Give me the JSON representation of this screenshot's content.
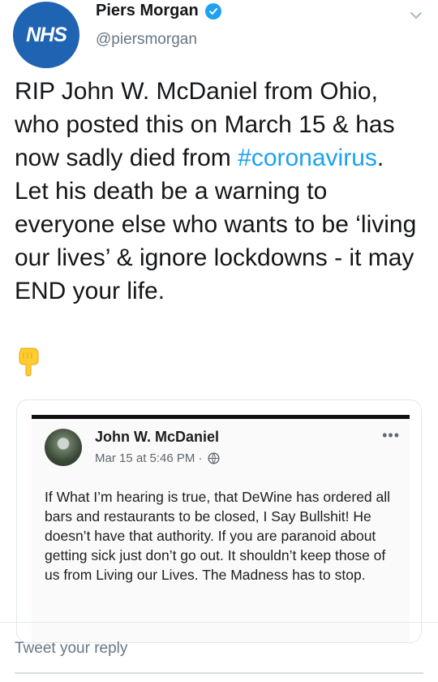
{
  "header": {
    "avatar_text": "NHS",
    "display_name": "Piers Morgan",
    "handle": "@piersmorgan",
    "verified": true
  },
  "tweet": {
    "text_before_hashtag": "RIP John W. McDaniel from Ohio, who posted this on March 15 & has now sadly died from ",
    "hashtag": "#coronavirus",
    "text_after_hashtag": ".",
    "text_line2": "Let his death be a warning to everyone else who wants to be ‘living our lives’ & ignore lockdowns - it may END your life.",
    "emoji": "backhand-index-pointing-down"
  },
  "embedded_post": {
    "author": "John W. McDaniel",
    "timestamp": "Mar 15 at 5:46 PM ·",
    "more": "•••",
    "body": "If What I’m hearing is true, that DeWine has ordered all bars and restaurants to be closed, I Say Bullshit! He doesn’t have that authority. If you are paranoid about getting sick just don’t go out. It shouldn’t keep those of us from Living our Lives. The Madness has to stop."
  },
  "reply": {
    "placeholder": "Tweet your reply"
  },
  "colors": {
    "link": "#1da1f2",
    "avatar_bg": "#1f63b3",
    "secondary_text": "#657786"
  }
}
